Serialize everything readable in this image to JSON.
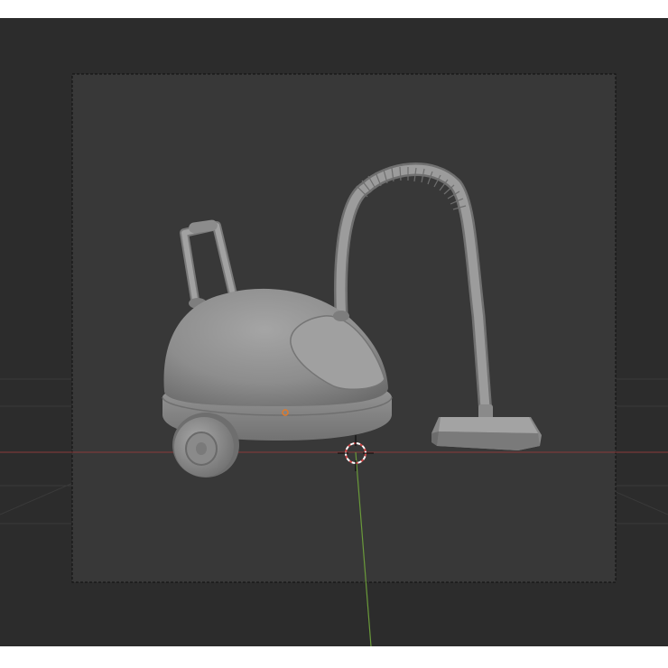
{
  "viewport": {
    "background": "#2c2c2c",
    "camera_frame_fill": "#383838",
    "x_axis_color": "#8a3a3a",
    "y_axis_color": "#6a9a3a",
    "origin_color": "#e07a2a",
    "cursor_color": "#d24b4b"
  },
  "object": {
    "name": "vacuum-cleaner",
    "material_color": "#8f8f8f"
  }
}
